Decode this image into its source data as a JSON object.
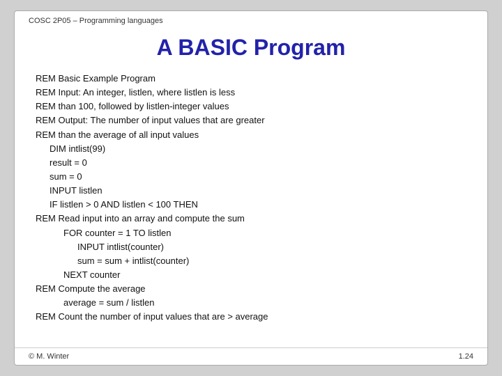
{
  "header": {
    "text": "COSC 2P05 – Programming languages"
  },
  "title": "A BASIC Program",
  "content": {
    "lines": [
      {
        "text": "REM Basic Example Program",
        "indent": 0
      },
      {
        "text": "REM Input: An integer, listlen, where listlen is less",
        "indent": 0
      },
      {
        "text": "REM than 100, followed by listlen-integer values",
        "indent": 0
      },
      {
        "text": "REM Output: The number of input values that are greater",
        "indent": 0
      },
      {
        "text": "REM than the average of all input values",
        "indent": 0
      },
      {
        "text": "DIM intlist(99)",
        "indent": 1
      },
      {
        "text": "result = 0",
        "indent": 1
      },
      {
        "text": "sum = 0",
        "indent": 1
      },
      {
        "text": "INPUT listlen",
        "indent": 1
      },
      {
        "text": "IF listlen > 0 AND listlen < 100 THEN",
        "indent": 1
      },
      {
        "text": "REM Read input into an array and compute the sum",
        "indent": 0
      },
      {
        "text": "FOR counter = 1 TO listlen",
        "indent": 2
      },
      {
        "text": "INPUT intlist(counter)",
        "indent": 3
      },
      {
        "text": "sum = sum + intlist(counter)",
        "indent": 3
      },
      {
        "text": "NEXT counter",
        "indent": 2
      },
      {
        "text": "REM Compute the average",
        "indent": 0
      },
      {
        "text": "average = sum / listlen",
        "indent": 2
      },
      {
        "text": "REM Count the number of input values that are > average",
        "indent": 0
      }
    ]
  },
  "footer": {
    "left": "© M. Winter",
    "right": "1.24"
  }
}
